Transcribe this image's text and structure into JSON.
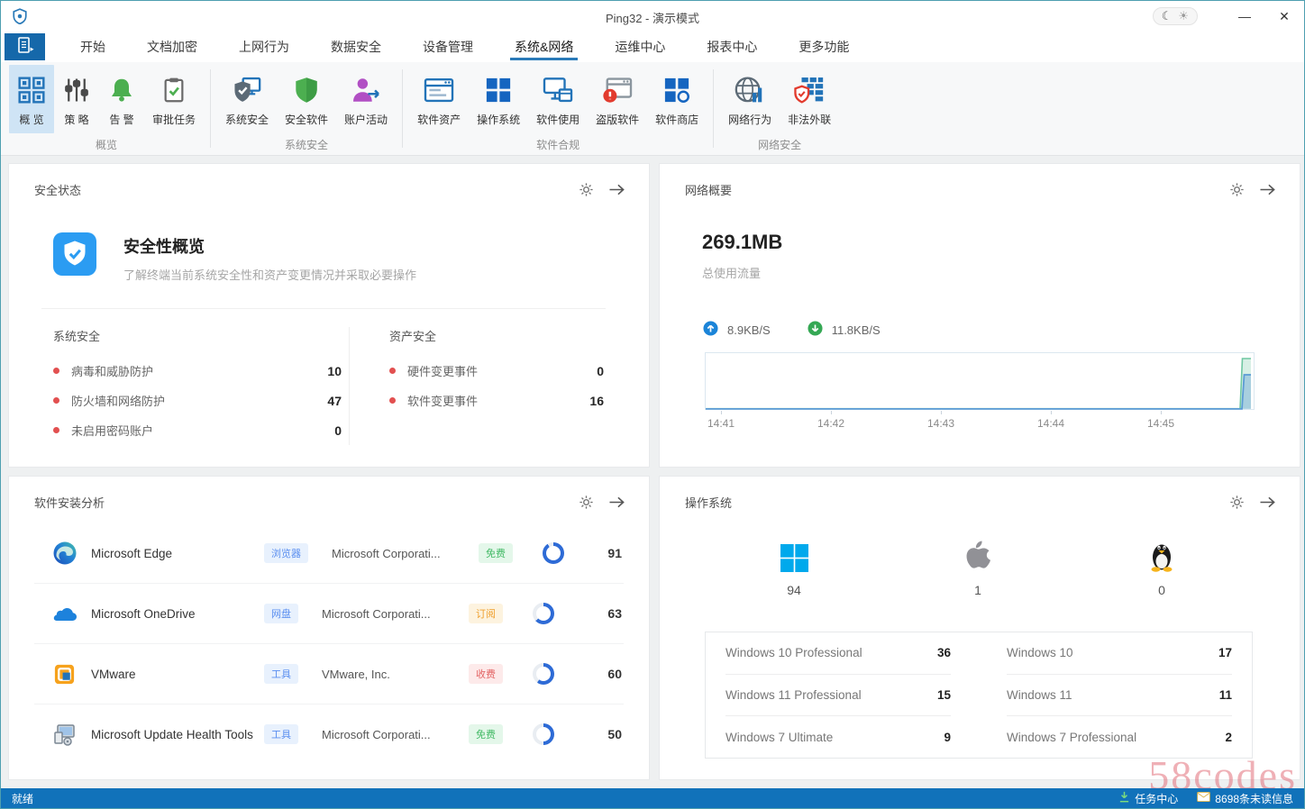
{
  "window": {
    "title": "Ping32 - 演示模式",
    "controls": {
      "theme_moon": "☾",
      "theme_sun": "☀",
      "minimize": "—",
      "close": "✕"
    }
  },
  "menu": {
    "active_tab": "系统&网络",
    "tabs": [
      "开始",
      "文档加密",
      "上网行为",
      "数据安全",
      "设备管理",
      "系统&网络",
      "运维中心",
      "报表中心",
      "更多功能"
    ]
  },
  "ribbon": {
    "groups": [
      {
        "label": "概览",
        "items": [
          {
            "label": "概 览",
            "icon": "overview-grid",
            "selected": true
          },
          {
            "label": "策 略",
            "icon": "policy-sliders"
          },
          {
            "label": "告 警",
            "icon": "alert-bell"
          },
          {
            "label": "审批任务",
            "icon": "approval-clipboard"
          }
        ]
      },
      {
        "label": "系统安全",
        "items": [
          {
            "label": "系统安全",
            "icon": "system-security-shield"
          },
          {
            "label": "安全软件",
            "icon": "security-software-shield"
          },
          {
            "label": "账户活动",
            "icon": "account-activity-user"
          }
        ]
      },
      {
        "label": "软件合规",
        "items": [
          {
            "label": "软件资产",
            "icon": "software-asset-window"
          },
          {
            "label": "操作系统",
            "icon": "os-grid"
          },
          {
            "label": "软件使用",
            "icon": "software-usage-monitor"
          },
          {
            "label": "盗版软件",
            "icon": "pirated-software-warning"
          },
          {
            "label": "软件商店",
            "icon": "software-store"
          }
        ]
      },
      {
        "label": "网络安全",
        "items": [
          {
            "label": "网络行为",
            "icon": "network-behavior-globe"
          },
          {
            "label": "非法外联",
            "icon": "illegal-connection-shield"
          }
        ]
      }
    ]
  },
  "panels": {
    "security_status": {
      "title": "安全状态",
      "card": {
        "title": "安全性概览",
        "subtitle": "了解终端当前系统安全性和资产变更情况并采取必要操作"
      },
      "columns": [
        {
          "header": "系统安全",
          "items": [
            {
              "label": "病毒和威胁防护",
              "value": "10"
            },
            {
              "label": "防火墙和网络防护",
              "value": "47"
            },
            {
              "label": "未启用密码账户",
              "value": "0"
            }
          ]
        },
        {
          "header": "资产安全",
          "items": [
            {
              "label": "硬件变更事件",
              "value": "0"
            },
            {
              "label": "软件变更事件",
              "value": "16"
            }
          ]
        }
      ]
    },
    "network_summary": {
      "title": "网络概要",
      "total": "269.1MB",
      "total_label": "总使用流量",
      "upload_speed": "8.9KB/S",
      "download_speed": "11.8KB/S",
      "chart": {
        "type": "area",
        "x_ticks": [
          "14:41",
          "14:42",
          "14:43",
          "14:44",
          "14:45"
        ],
        "series": [
          {
            "name": "download",
            "color": "#6fc7a2",
            "shape": "flat near zero, spike to max at right edge"
          },
          {
            "name": "upload",
            "color": "#5b9bd5",
            "shape": "flat near zero, spike to ~60% at right edge"
          }
        ]
      }
    },
    "software_analysis": {
      "title": "软件安装分析",
      "rows": [
        {
          "icon": "edge",
          "name": "Microsoft Edge",
          "category": "浏览器",
          "vendor": "Microsoft Corporati...",
          "price_label": "免费",
          "price_type": "free",
          "count": 91
        },
        {
          "icon": "onedrive",
          "name": "Microsoft OneDrive",
          "category": "网盘",
          "vendor": "Microsoft Corporati...",
          "price_label": "订阅",
          "price_type": "subscription",
          "count": 63
        },
        {
          "icon": "vmware",
          "name": "VMware",
          "category": "工具",
          "vendor": "VMware, Inc.",
          "price_label": "收费",
          "price_type": "paid",
          "count": 60
        },
        {
          "icon": "update-health-tools",
          "name": "Microsoft Update Health Tools",
          "category": "工具",
          "vendor": "Microsoft Corporati...",
          "price_label": "免费",
          "price_type": "free",
          "count": 50
        }
      ]
    },
    "operating_system": {
      "title": "操作系统",
      "summary": [
        {
          "icon": "windows-logo",
          "name": "windows",
          "count": "94"
        },
        {
          "icon": "apple-logo",
          "name": "apple",
          "count": "1"
        },
        {
          "icon": "linux-logo",
          "name": "linux",
          "count": "0"
        }
      ],
      "table_rows": [
        [
          {
            "label": "Windows 10 Professional",
            "value": "36"
          },
          {
            "label": "Windows 10",
            "value": "17"
          }
        ],
        [
          {
            "label": "Windows 11 Professional",
            "value": "15"
          },
          {
            "label": "Windows 11",
            "value": "11"
          }
        ],
        [
          {
            "label": "Windows 7 Ultimate",
            "value": "9"
          },
          {
            "label": "Windows 7 Professional",
            "value": "2"
          }
        ]
      ]
    }
  },
  "status_bar": {
    "ready": "就绪",
    "task_center": "任务中心",
    "unread": "8698条未读信息"
  },
  "watermark": "58codes",
  "colors": {
    "accent": "#1876bd",
    "status_bar": "#1172ba",
    "selected_tile": "#cfe4f5",
    "ring": "#2e6bd6",
    "red_dot": "#e25050"
  }
}
